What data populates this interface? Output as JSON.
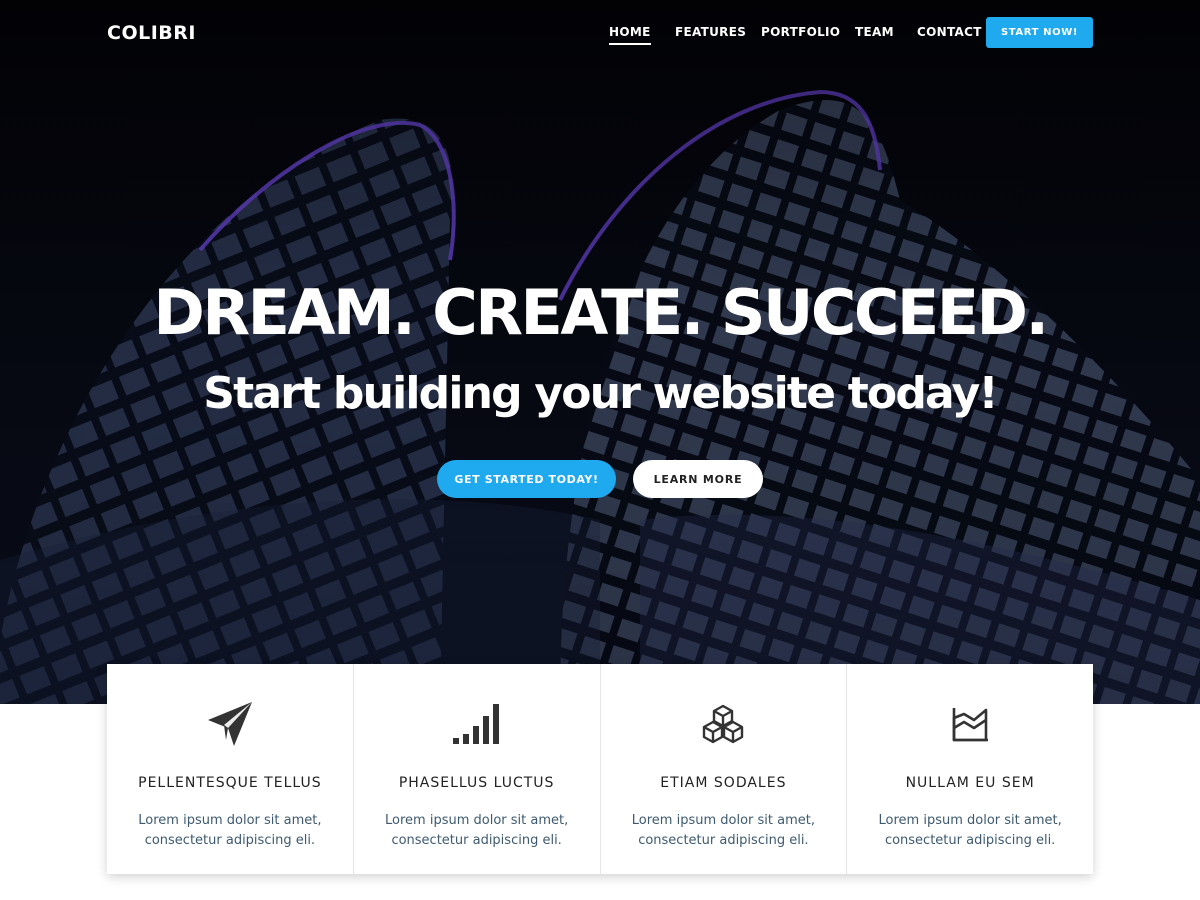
{
  "header": {
    "logo": "COLIBRI",
    "nav": [
      {
        "label": "HOME",
        "active": true
      },
      {
        "label": "FEATURES",
        "active": false
      },
      {
        "label": "PORTFOLIO",
        "active": false
      },
      {
        "label": "TEAM",
        "active": false
      },
      {
        "label": "CONTACT",
        "active": false
      }
    ],
    "cta_label": "START NOW!"
  },
  "hero": {
    "headline": "DREAM. CREATE. SUCCEED.",
    "subheadline": "Start building your website today!",
    "primary_button": "GET STARTED TODAY!",
    "secondary_button": "LEARN MORE",
    "background_image": "night-skyscraper-photo"
  },
  "features": [
    {
      "icon": "paper-plane-icon",
      "title": "PELLENTESQUE TELLUS",
      "line1": "Lorem ipsum dolor sit amet,",
      "line2": "consectetur adipiscing eli."
    },
    {
      "icon": "signal-bars-icon",
      "title": "PHASELLUS LUCTUS",
      "line1": "Lorem ipsum dolor sit amet,",
      "line2": "consectetur adipiscing eli."
    },
    {
      "icon": "cubes-icon",
      "title": "ETIAM SODALES",
      "line1": "Lorem ipsum dolor sit amet,",
      "line2": "consectetur adipiscing eli."
    },
    {
      "icon": "area-chart-icon",
      "title": "NULLAM EU SEM",
      "line1": "Lorem ipsum dolor sit amet,",
      "line2": "consectetur adipiscing eli."
    }
  ],
  "colors": {
    "accent": "#1fa9ef",
    "hero_background": "#05050d",
    "description_text": "#3e5a70"
  }
}
